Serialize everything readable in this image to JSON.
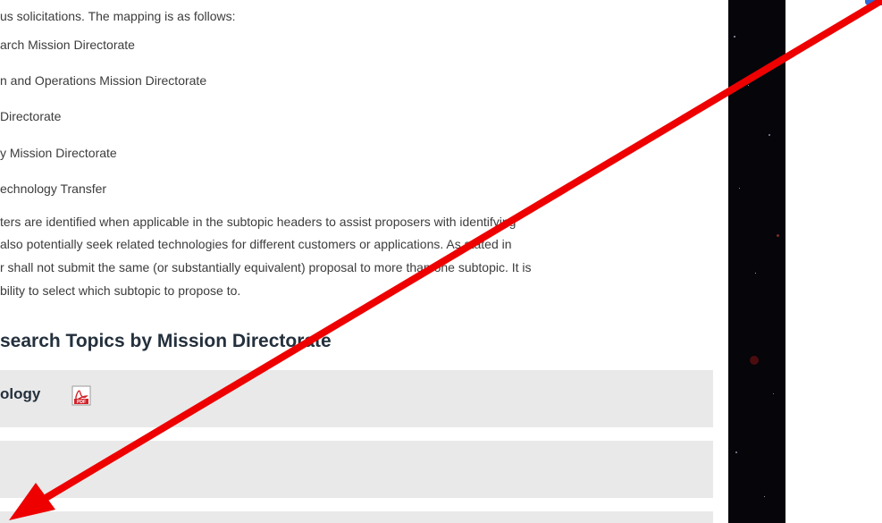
{
  "paragraph1": {
    "lines": [
      "us solicitations. The mapping is as follows:",
      "arch Mission Directorate",
      "n and Operations Mission Directorate",
      "Directorate",
      "y Mission Directorate",
      "echnology Transfer"
    ]
  },
  "paragraph2": {
    "lines": [
      "ters are identified when applicable in the subtopic headers to assist proposers with identifying",
      " also potentially seek related technologies for different customers or applications. As stated in",
      "r shall not submit the same (or substantially equivalent) proposal to more than one subtopic. It is",
      "bility to select which subtopic to propose to."
    ]
  },
  "section": {
    "heading": "search Topics by Mission Directorate"
  },
  "accordion": {
    "items": [
      {
        "label": "ology",
        "icon": "pdf-icon"
      },
      {
        "label": ""
      },
      {
        "label": ""
      }
    ]
  },
  "annotation": {
    "color": "#ee0000",
    "shape": "arrow",
    "icon": "red-arrow"
  },
  "colors": {
    "text": "#3c3c3c",
    "heading": "#24303d",
    "bar_bg": "#e9e9e9",
    "space_bg": "#05050a",
    "corner_tab": "#2f6bd6"
  }
}
